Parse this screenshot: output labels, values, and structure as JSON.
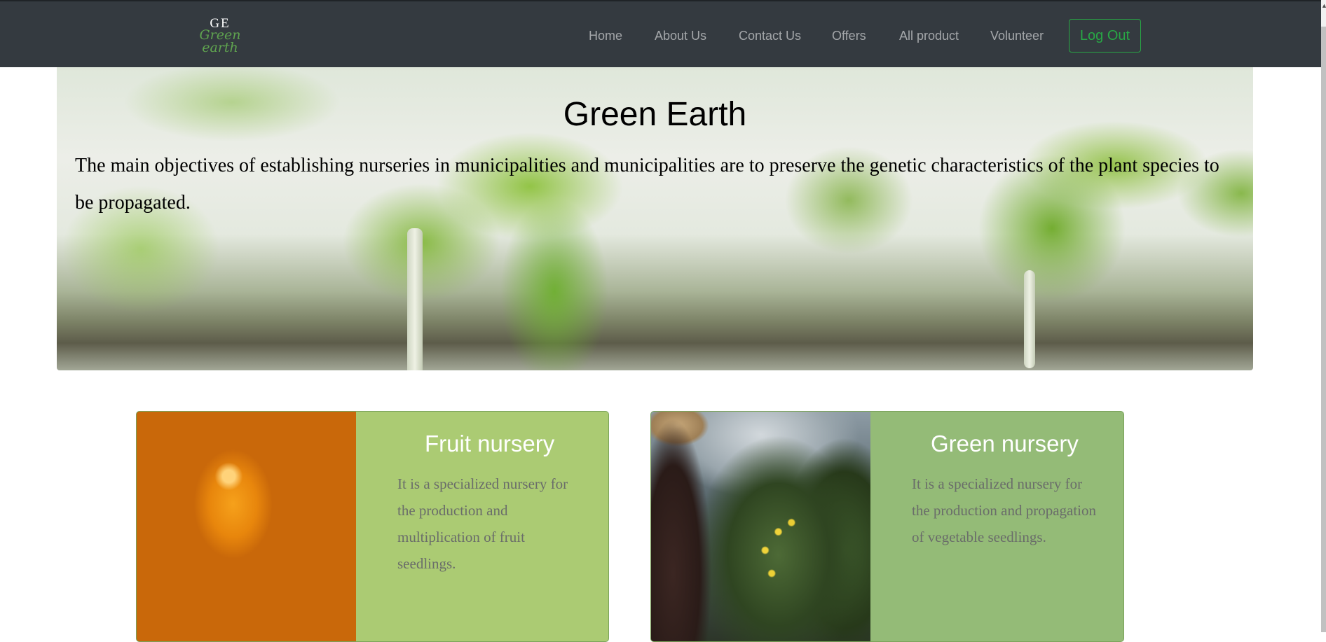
{
  "navbar": {
    "brand_mono": "GE",
    "brand_name": "Green earth",
    "links": [
      "Home",
      "About Us",
      "Contact Us",
      "Offers",
      "All product",
      "Volunteer"
    ],
    "logout_label": "Log Out"
  },
  "hero": {
    "title": "Green Earth",
    "text": "The main objectives of establishing nurseries in municipalities and municipalities are to preserve the genetic characteristics of the plant species to be propagated."
  },
  "cards": [
    {
      "title": "Fruit nursery",
      "text": "It is a specialized nursery for the production and multiplication of fruit seedlings."
    },
    {
      "title": "Green nursery",
      "text": "It is a specialized nursery for the production and propagation of vegetable seedlings."
    }
  ],
  "colors": {
    "navbar_bg": "#343a40",
    "logout_accent": "#28a745",
    "fruit_card_bg": "#abcb73",
    "green_card_bg": "#94bb77"
  },
  "icons": {
    "scroll_up": "scroll-up-arrow-icon"
  }
}
